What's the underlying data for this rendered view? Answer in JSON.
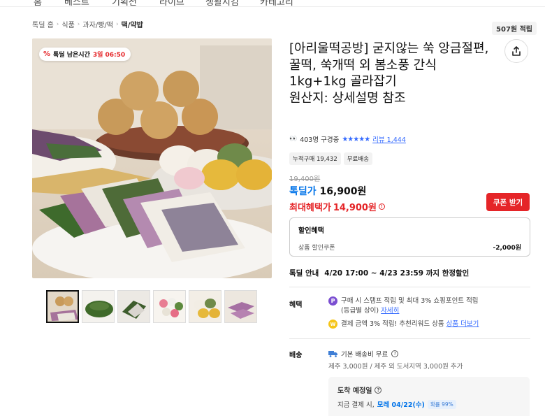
{
  "top_nav": {
    "items": [
      "홈",
      "베스트",
      "기획전",
      "라이브",
      "생활지킴",
      "카테고리"
    ]
  },
  "breadcrumb": [
    "톡딜 홈",
    "식품",
    "과자/빵/떡",
    "떡/약밥"
  ],
  "points_badge": "507원 적립",
  "timer": {
    "icon_text": "%",
    "label": "톡딜 남은시간",
    "value": "3일 06:50"
  },
  "product": {
    "title": "[아리울떡공방] 굳지않는 쑥 앙금절편, 꿀떡, 쑥개떡 외 봄소풍 간식 1kg+1kg 골라잡기\n원산지: 상세설명 참조"
  },
  "reviews": {
    "watchers": "403명 구경중",
    "stars": "★★★★★",
    "review_link": "리뷰 1,444"
  },
  "tags": [
    "누적구매 19,432",
    "무료배송"
  ],
  "price": {
    "original": "19,400원",
    "deal_label": "톡딜가",
    "deal_price": "16,900원",
    "max_label": "최대혜택가",
    "max_price": "14,900원",
    "coupon_button": "쿠폰 받기"
  },
  "discount": {
    "heading": "할인혜택",
    "row_label": "상품 할인쿠폰",
    "row_amount": "-2,000원"
  },
  "deal_info": {
    "label": "톡딜 안내",
    "period": "4/20 17:00 ~ 4/23 23:59 까지 한정할인"
  },
  "benefits": {
    "label": "혜택",
    "line1_icon": "P",
    "line1_a": "구매 시 스탬프 적립 및 최대 3% 쇼핑포인트 적립",
    "line1_b": "(등급별 상이)",
    "line1_link": "자세히",
    "line2_icon": "W",
    "line2_text": "결제 금액 3% 적립! 추천리워드 상품",
    "line2_link": "상품 더보기"
  },
  "shipping": {
    "label": "배송",
    "base": "기본 배송비 무료",
    "extra": "제주 3,000원 / 제주 외 도서지역 3,000원 추가"
  },
  "arrival": {
    "heading": "도착 예정일",
    "prefix": "지금 결제 시,",
    "date": "모레 04/22(수)",
    "probability": "확률 99%"
  },
  "colors": {
    "accent_red": "#e52528",
    "accent_blue": "#0073e9",
    "link_blue": "#346aff"
  }
}
